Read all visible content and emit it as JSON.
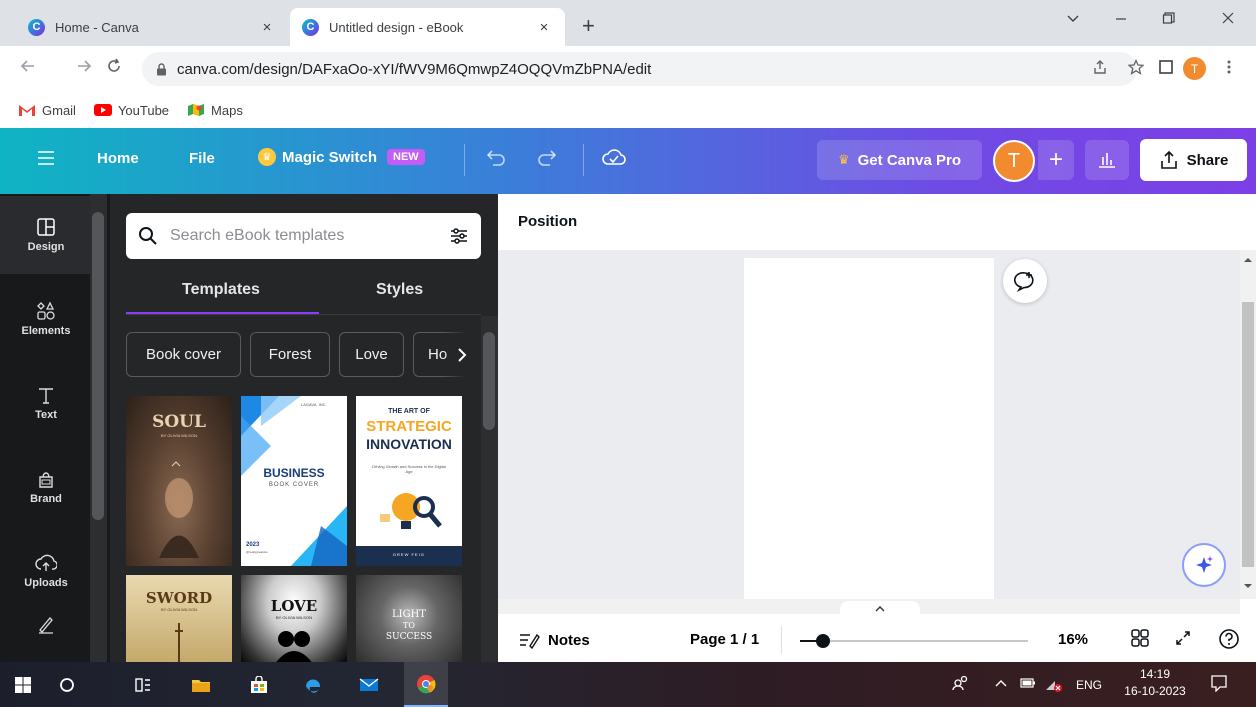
{
  "browser": {
    "tabs": [
      {
        "title": "Home - Canva",
        "close": "×"
      },
      {
        "title": "Untitled design - eBook",
        "close": "×"
      }
    ],
    "new_tab": "+",
    "url": "canva.com/design/DAFxaOo-xYI/fWV9M6QmwpZ4OQQVmZbPNA/edit",
    "profile_initial": "T",
    "bookmarks": [
      {
        "label": "Gmail",
        "icon": "gmail-icon"
      },
      {
        "label": "YouTube",
        "icon": "youtube-icon"
      },
      {
        "label": "Maps",
        "icon": "maps-icon"
      }
    ]
  },
  "header": {
    "home": "Home",
    "file": "File",
    "magic_switch": "Magic Switch",
    "new_badge": "NEW",
    "get_pro": "Get Canva Pro",
    "user_initial": "T",
    "plus": "+",
    "share": "Share"
  },
  "rail": {
    "items": [
      {
        "label": "Design",
        "icon": "design-icon"
      },
      {
        "label": "Elements",
        "icon": "elements-icon"
      },
      {
        "label": "Text",
        "icon": "text-icon"
      },
      {
        "label": "Brand",
        "icon": "brand-icon"
      },
      {
        "label": "Uploads",
        "icon": "uploads-icon"
      }
    ]
  },
  "panel": {
    "search_placeholder": "Search eBook templates",
    "tabs": [
      "Templates",
      "Styles"
    ],
    "chips": [
      "Book cover",
      "Forest",
      "Love",
      "Ho"
    ],
    "templates": {
      "soul": {
        "title": "SOUL",
        "author": "BY OLIVIA WILSON"
      },
      "business": {
        "top": "LAGAVA, INC.",
        "title": "BUSINESS",
        "subtitle": "BOOK COVER",
        "year": "2023",
        "site": "@reallygreatsite"
      },
      "strategic": {
        "line1": "THE ART OF",
        "line2": "STRATEGIC",
        "line3": "INNOVATION",
        "tagline": "Driving Growth and Success in the Digital Age",
        "author": "DREW FEIG"
      },
      "sword": {
        "title": "SWORD",
        "author": "BY OLIVIA WILSON"
      },
      "love": {
        "title": "LOVE",
        "author": "BY OLIVIA WILSON"
      },
      "light": {
        "line1": "LIGHT",
        "line2": "TO",
        "line3": "SUCCESS"
      }
    }
  },
  "editor": {
    "position_label": "Position",
    "notes": "Notes",
    "page_info": "Page 1 / 1",
    "zoom_percent": "16%",
    "zoom_value": 16
  },
  "taskbar": {
    "tray_lang": "ENG",
    "time": "14:19",
    "date": "16-10-2023"
  },
  "colors": {
    "header_start": "#0fb4c3",
    "header_end": "#7c3fe6",
    "accent": "#8b3dff",
    "avatar": "#f28b30"
  }
}
